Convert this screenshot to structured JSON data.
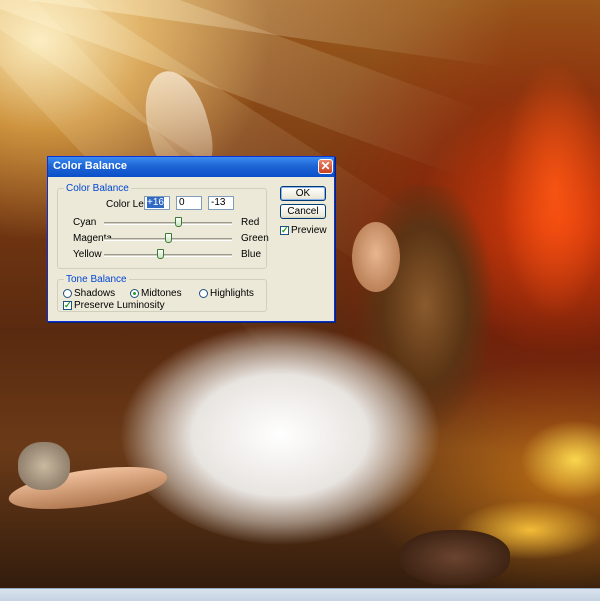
{
  "dialog": {
    "title": "Color Balance",
    "color_balance_group": "Color Balance",
    "color_levels_label": "Color Levels:",
    "levels": [
      "+16",
      "0",
      "-13"
    ],
    "sliders": [
      {
        "left": "Cyan",
        "right": "Red",
        "value": 16
      },
      {
        "left": "Magenta",
        "right": "Green",
        "value": 0
      },
      {
        "left": "Yellow",
        "right": "Blue",
        "value": -13
      }
    ],
    "tone_balance_group": "Tone Balance",
    "tones": [
      {
        "label": "Shadows",
        "selected": false
      },
      {
        "label": "Midtones",
        "selected": true
      },
      {
        "label": "Highlights",
        "selected": false
      }
    ],
    "preserve_luminosity": {
      "label": "Preserve Luminosity",
      "checked": true
    },
    "ok_label": "OK",
    "cancel_label": "Cancel",
    "preview": {
      "label": "Preview",
      "checked": true
    }
  },
  "slider_range": [
    -100,
    100
  ],
  "colors": {
    "titlebar": "#0a4ec8",
    "dialog_bg": "#ece9d8",
    "legend_text": "#0046d5",
    "selection": "#316ac5",
    "check": "#21a121"
  },
  "icons": {
    "close": "close-icon",
    "check": "checkmark-icon"
  }
}
